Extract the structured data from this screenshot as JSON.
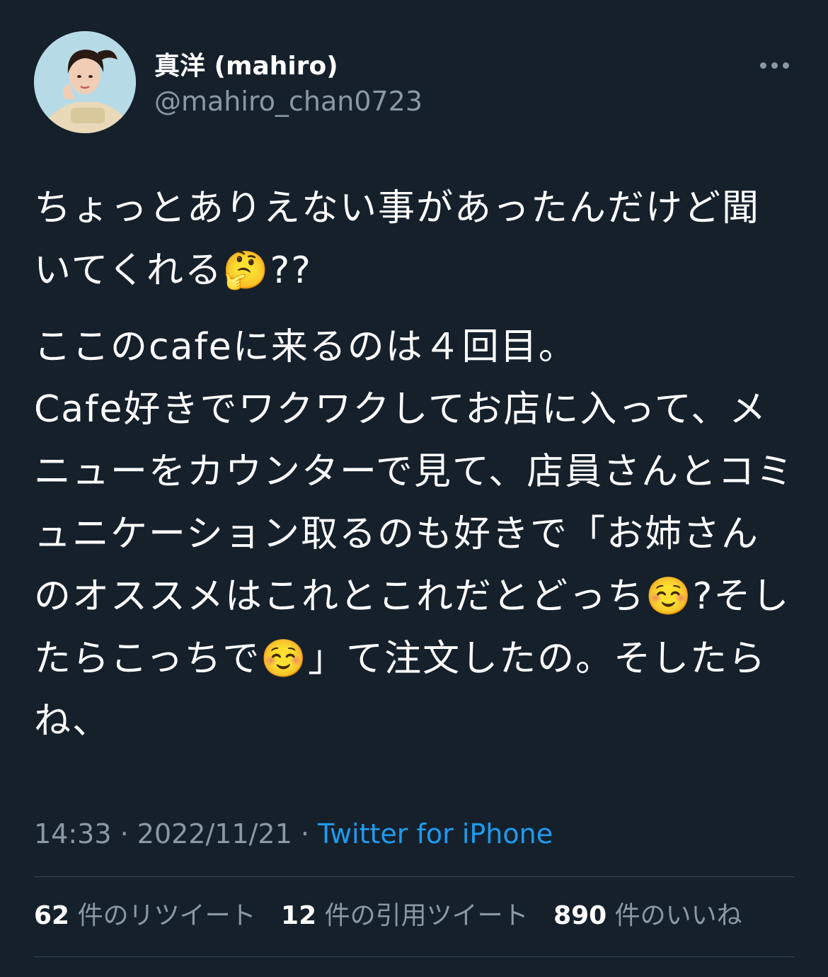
{
  "tweet": {
    "display_name": "真洋 (mahiro)",
    "handle": "@mahiro_chan0723",
    "avatar_icon": "profile-photo",
    "more_icon": "more-horizontal-icon",
    "paragraphs": [
      "ちょっとありえない事があったんだけど聞いてくれる🤔??",
      "ここのcafeに来るのは４回目。\nCafe好きでワクワクしてお店に入って、メニューをカウンターで見て、店員さんとコミュニケーション取るのも好きで「お姉さんのオススメはこれとこれだとどっち☺️?そしたらこっちで☺️」て注文したの。そしたらね、"
    ],
    "time": "14:33",
    "separator": " · ",
    "date": "2022/11/21",
    "source": "Twitter for iPhone"
  },
  "stats": {
    "retweets": {
      "count": "62",
      "label": "件のリツイート"
    },
    "quotes": {
      "count": "12",
      "label": "件の引用ツイート"
    },
    "likes": {
      "count": "890",
      "label": "件のいいね"
    }
  },
  "colors": {
    "background": "#15202b",
    "text": "#ffffff",
    "secondary_text": "#8b98a5",
    "link": "#1d9bf0",
    "divider": "#38444d"
  }
}
